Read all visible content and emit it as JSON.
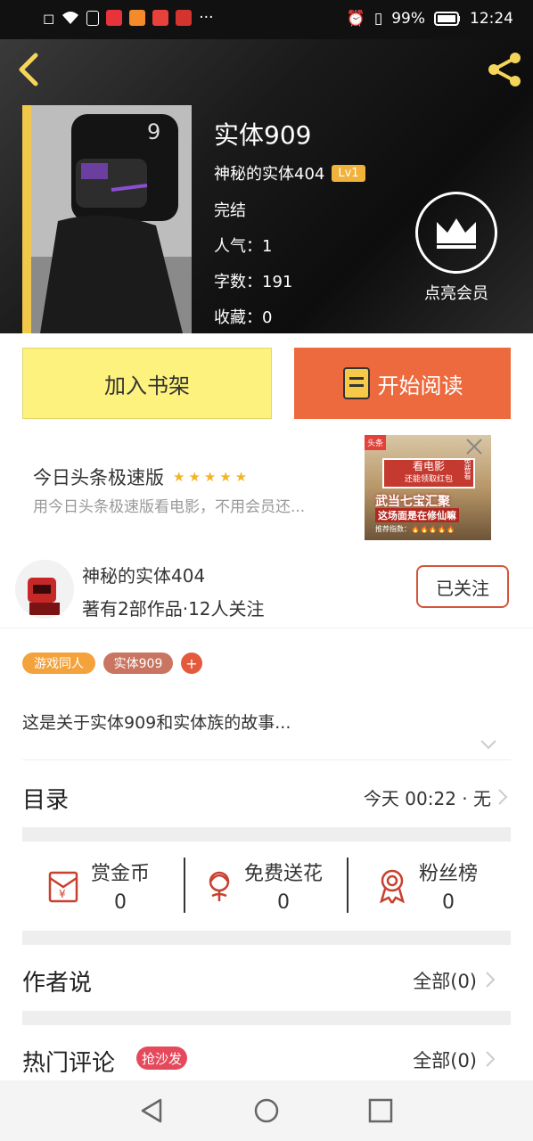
{
  "status_bar": {
    "battery": "99%",
    "time": "12:24",
    "more": "···"
  },
  "book": {
    "title": "实体909",
    "author": "神秘的实体404",
    "level": "Lv1",
    "status": "完结",
    "popularity": "人气：1",
    "word_count": "字数：191",
    "collections": "收藏：0",
    "vip_label": "点亮会员"
  },
  "actions": {
    "add_shelf": "加入书架",
    "start_reading": "开始阅读"
  },
  "ad": {
    "title": "今日头条极速版",
    "stars": "★★★★★",
    "desc": "用今日头条极速版看电影，不用会员还...",
    "img_line1": "看电影",
    "img_line2": "还能领取红包",
    "img_line3": "武当七宝汇聚",
    "img_line4": "这场面是在修仙嘛",
    "img_line5": "推荐指数：🔥🔥🔥🔥🔥",
    "badge": "头条",
    "free": "免费看"
  },
  "author": {
    "name": "神秘的实体404",
    "stats": "著有2部作品·12人关注",
    "follow_label": "已关注"
  },
  "tags": [
    "游戏同人",
    "实体909",
    "+"
  ],
  "description": "这是关于实体909和实体族的故事...",
  "toc": {
    "title": "目录",
    "update": "今天 00:22 · 无"
  },
  "rewards": [
    {
      "label": "赏金币",
      "value": "0"
    },
    {
      "label": "免费送花",
      "value": "0"
    },
    {
      "label": "粉丝榜",
      "value": "0"
    }
  ],
  "author_says": {
    "title": "作者说",
    "all": "全部(0)"
  },
  "hot_comments": {
    "title": "热门评论",
    "badge": "抢沙发",
    "all": "全部(0)"
  },
  "colors": {
    "accent_orange": "#ec6a3e",
    "shelf_yellow": "#fdf27d",
    "level_gold": "#f0b23a",
    "tag_orange": "#f4a23c",
    "tag_brown": "#c97561",
    "tag_red": "#e45a3d",
    "icon_red": "#c8402f"
  }
}
